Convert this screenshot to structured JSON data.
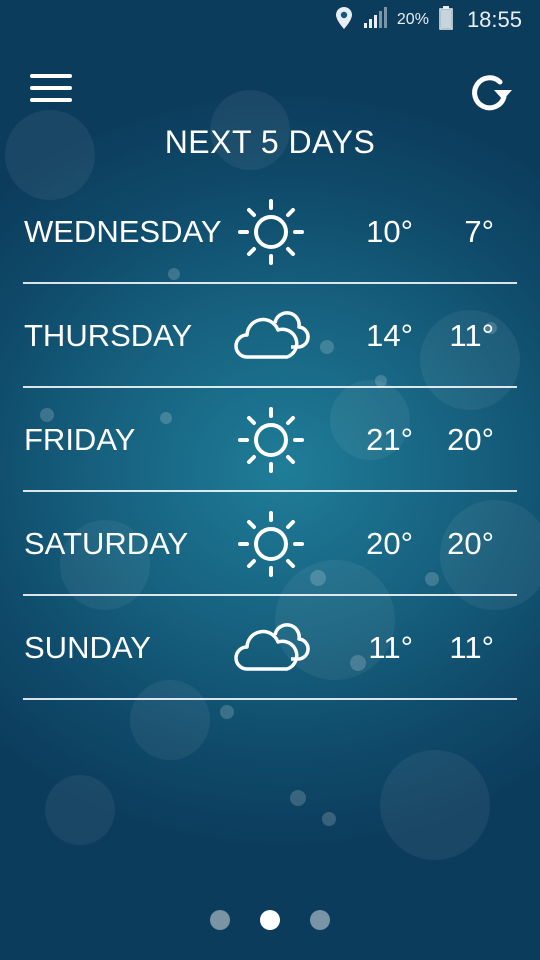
{
  "status_bar": {
    "battery_percent": "20%",
    "time": "18:55",
    "icons": [
      "location-pin-icon",
      "signal-icon",
      "battery-icon"
    ]
  },
  "header": {
    "title": "NEXT 5 DAYS",
    "menu_icon": "hamburger-menu-icon",
    "refresh_icon": "refresh-icon"
  },
  "forecast": [
    {
      "day": "WEDNESDAY",
      "icon": "sun-icon",
      "high": "10°",
      "low": "7°"
    },
    {
      "day": "THURSDAY",
      "icon": "cloud-icon",
      "high": "14°",
      "low": "11°"
    },
    {
      "day": "FRIDAY",
      "icon": "sun-icon",
      "high": "21°",
      "low": "20°"
    },
    {
      "day": "SATURDAY",
      "icon": "sun-icon",
      "high": "20°",
      "low": "20°"
    },
    {
      "day": "SUNDAY",
      "icon": "cloud-icon",
      "high": "11°",
      "low": "11°"
    }
  ],
  "pager": {
    "page_count": 3,
    "active_page": 2
  },
  "colors": {
    "background": "#16607e",
    "text": "#ffffff",
    "divider": "#ffffff"
  }
}
